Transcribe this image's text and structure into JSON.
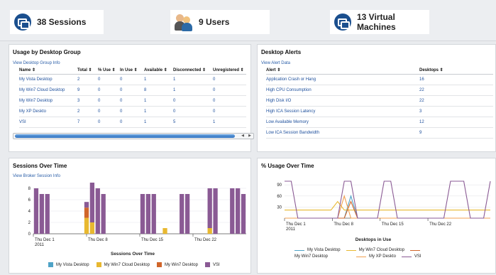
{
  "stats": {
    "sessions": "38 Sessions",
    "users": "9 Users",
    "vms": "13 Virtual Machines"
  },
  "desktop_group": {
    "title": "Usage by Desktop Group",
    "link": "View Desktop Group Info",
    "columns": [
      "Name ⇕",
      "Total ⇕",
      "% Use ⇕",
      "In Use ⇕",
      "Available ⇕",
      "Disconnected ⇕",
      "Unregistered ⇕"
    ],
    "rows": [
      [
        "My Vista Desktop",
        "2",
        "0",
        "0",
        "1",
        "1",
        "0"
      ],
      [
        "My Win7 Cloud Desktop",
        "9",
        "0",
        "0",
        "8",
        "1",
        "0"
      ],
      [
        "My Win7 Desktop",
        "3",
        "0",
        "0",
        "1",
        "0",
        "0"
      ],
      [
        "My XP Deskto",
        "2",
        "0",
        "0",
        "1",
        "0",
        "0"
      ],
      [
        "VSI",
        "7",
        "0",
        "0",
        "1",
        "5",
        "1"
      ]
    ]
  },
  "alerts": {
    "title": "Desktop Alerts",
    "link": "View Alert Data",
    "columns": [
      "Alert ⇕",
      "Desktops ⇕"
    ],
    "rows": [
      [
        "Application Crash or Hang",
        "16"
      ],
      [
        "High CPU Consumption",
        "22"
      ],
      [
        "High Disk I/O",
        "22"
      ],
      [
        "High ICA Session Latency",
        "3"
      ],
      [
        "Low Available Memory",
        "12"
      ],
      [
        "Low ICA Session Bandwidth",
        "9"
      ]
    ]
  },
  "sessions_panel": {
    "title": "Sessions Over Time",
    "link": "View Broker Session Info"
  },
  "usage_panel": {
    "title": "% Usage Over Time"
  },
  "colors": {
    "vista": "#4fa3c7",
    "cloud": "#e8b830",
    "win7": "#d0652a",
    "vsi": "#8a5a94",
    "xp": "#f0a050",
    "brand": "#1b4f8e"
  },
  "chart_data": [
    {
      "type": "bar",
      "title": "",
      "xlabel": "Sessions Over Time",
      "ylabel": "",
      "ylim": [
        0,
        9
      ],
      "yticks": [
        "8",
        "6",
        "4",
        "2",
        "0"
      ],
      "xtick_labels": [
        "Thu Dec 1\n2011",
        "Thu Dec 8",
        "Thu Dec 15",
        "Thu Dec 22"
      ],
      "stacked": true,
      "series": [
        {
          "name": "My Vista Desktop",
          "values": [
            0,
            0,
            0,
            0,
            0,
            0,
            0,
            0,
            0,
            0,
            0,
            0,
            0,
            0,
            0,
            0,
            0,
            0,
            0,
            0,
            0,
            0,
            0,
            0,
            0,
            0,
            0,
            0,
            0,
            0,
            0,
            0,
            0,
            0,
            0,
            0,
            0,
            0
          ]
        },
        {
          "name": "My Win7 Cloud Desktop",
          "values": [
            0,
            0,
            0,
            0,
            0,
            0,
            0,
            0,
            0,
            2.8,
            2,
            0,
            0,
            0,
            0,
            0,
            0,
            0,
            0,
            0,
            0,
            0,
            0,
            1,
            0,
            0,
            0,
            0,
            0,
            0,
            0,
            1,
            0,
            0,
            0,
            0,
            0,
            0
          ]
        },
        {
          "name": "My Win7 Desktop",
          "values": [
            0,
            0,
            0,
            0,
            0,
            0,
            0,
            0,
            0,
            1.8,
            0,
            0,
            0,
            0,
            0,
            0,
            0,
            0,
            0,
            0,
            0,
            0,
            0,
            0,
            0,
            0,
            0,
            0,
            0,
            0,
            0,
            0,
            0,
            0,
            0,
            0,
            0,
            0
          ]
        },
        {
          "name": "VSI",
          "values": [
            8,
            7,
            7,
            0,
            0,
            0,
            0,
            0,
            0,
            1,
            7,
            8,
            7,
            0,
            0,
            0,
            0,
            0,
            0,
            7,
            7,
            7,
            0,
            0,
            0,
            0,
            7,
            7,
            0,
            0,
            0,
            7,
            8,
            0,
            0,
            8,
            8,
            7
          ]
        }
      ]
    },
    {
      "type": "line",
      "title": "",
      "xlabel": "Desktops in Use",
      "ylabel": "",
      "ylim": [
        0,
        100
      ],
      "yticks": [
        "90",
        "60",
        "30"
      ],
      "xtick_labels": [
        "Thu Dec 1\n2011",
        "Thu Dec 8",
        "Thu Dec 15",
        "Thu Dec 22"
      ],
      "series": [
        {
          "name": "My Vista Desktop",
          "values": [
            0,
            0,
            0,
            0,
            0,
            0,
            0,
            0,
            0,
            0,
            60,
            0,
            0,
            0,
            0,
            0,
            0,
            0,
            0,
            0,
            0,
            0,
            0,
            0,
            0,
            0,
            0,
            0,
            0,
            0,
            0,
            0
          ]
        },
        {
          "name": "My Win7 Cloud Desktop",
          "values": [
            22,
            22,
            22,
            22,
            22,
            22,
            22,
            22,
            45,
            22,
            22,
            22,
            22,
            22,
            22,
            22,
            22,
            22,
            22,
            22,
            22,
            22,
            22,
            22,
            22,
            22,
            22,
            22,
            22,
            22,
            22,
            22
          ]
        },
        {
          "name": "My Win7 Desktop",
          "values": [
            0,
            0,
            0,
            0,
            0,
            0,
            0,
            0,
            0,
            0,
            45,
            0,
            0,
            0,
            0,
            0,
            0,
            0,
            0,
            0,
            0,
            0,
            0,
            0,
            0,
            0,
            0,
            0,
            0,
            0,
            0,
            0
          ]
        },
        {
          "name": "My XP Deskto",
          "values": [
            0,
            0,
            0,
            0,
            0,
            0,
            0,
            0,
            0,
            60,
            0,
            0,
            0,
            0,
            0,
            0,
            0,
            0,
            0,
            0,
            0,
            0,
            0,
            0,
            0,
            0,
            0,
            0,
            0,
            0,
            0,
            0
          ]
        },
        {
          "name": "VSI",
          "values": [
            100,
            100,
            0,
            0,
            0,
            0,
            0,
            0,
            0,
            100,
            100,
            0,
            0,
            0,
            0,
            100,
            100,
            0,
            0,
            0,
            0,
            0,
            0,
            0,
            0,
            100,
            100,
            100,
            0,
            0,
            0,
            100
          ]
        }
      ]
    }
  ]
}
